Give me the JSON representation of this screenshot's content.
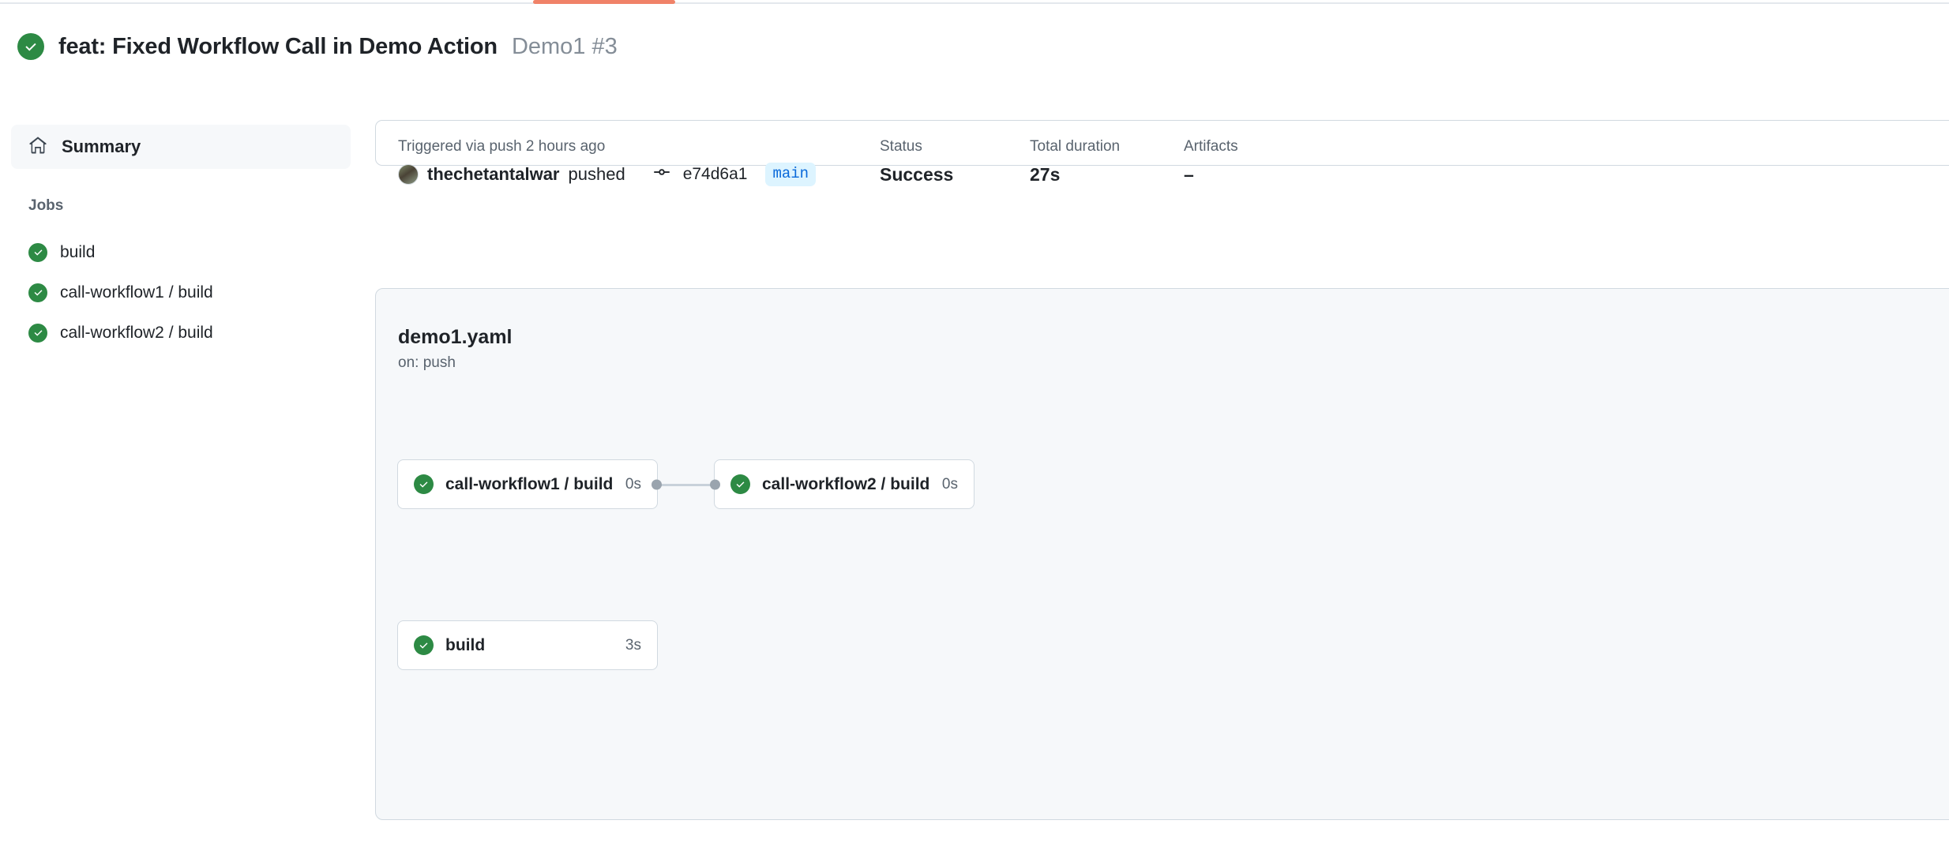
{
  "tabstrip": {
    "active_tab_indicator": "actions-tab-underline"
  },
  "header": {
    "status_icon": "check-circle-icon",
    "title": "feat: Fixed Workflow Call in Demo Action",
    "run_ref": "Demo1 #3"
  },
  "sidebar": {
    "summary": {
      "icon": "home-icon",
      "label": "Summary"
    },
    "jobs_heading": "Jobs",
    "jobs": [
      {
        "label": "build",
        "status_icon": "check-circle-icon"
      },
      {
        "label": "call-workflow1 / build",
        "status_icon": "check-circle-icon"
      },
      {
        "label": "call-workflow2 / build",
        "status_icon": "check-circle-icon"
      }
    ]
  },
  "info_card": {
    "trigger": {
      "label": "Triggered via push 2 hours ago",
      "avatar": "user-avatar",
      "actor": "thechetantalwar",
      "action": "pushed",
      "commit_icon": "git-commit-icon",
      "commit_sha": "e74d6a1",
      "branch": "main"
    },
    "status": {
      "label": "Status",
      "value": "Success"
    },
    "duration": {
      "label": "Total duration",
      "value": "27s"
    },
    "artifacts": {
      "label": "Artifacts",
      "value": "–"
    }
  },
  "graph": {
    "workflow_file": "demo1.yaml",
    "trigger_event": "on: push",
    "nodes": [
      {
        "id": "n1",
        "label": "call-workflow1 / build",
        "duration": "0s",
        "status_icon": "check-circle-icon"
      },
      {
        "id": "n2",
        "label": "call-workflow2 / build",
        "duration": "0s",
        "status_icon": "check-circle-icon"
      },
      {
        "id": "n3",
        "label": "build",
        "duration": "3s",
        "status_icon": "check-circle-icon"
      }
    ]
  },
  "colors": {
    "success_green": "#2d8a44",
    "tab_accent": "#f08268",
    "branch_badge_bg": "#ddf4ff",
    "branch_badge_fg": "#0969da",
    "panel_bg": "#f6f8fa",
    "border": "#d1d9e0"
  }
}
